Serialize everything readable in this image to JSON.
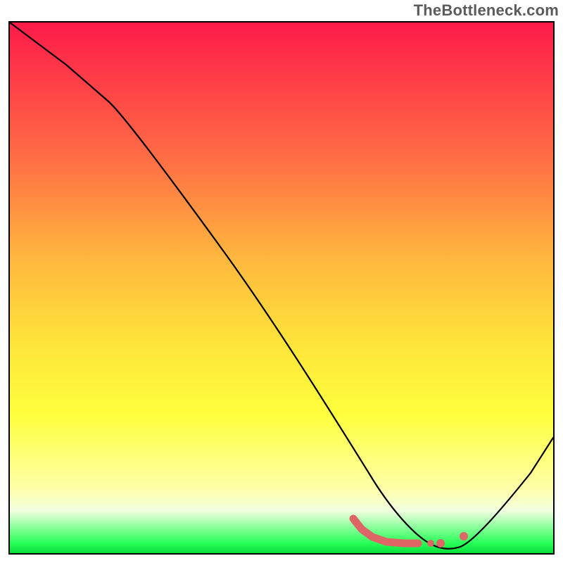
{
  "brand": {
    "watermark": "TheBottleneck.com"
  },
  "chart_data": {
    "type": "line",
    "title": "",
    "xlabel": "",
    "ylabel": "",
    "xlim": [
      0,
      100
    ],
    "ylim": [
      0,
      100
    ],
    "series": [
      {
        "name": "bottleneck-curve",
        "x": [
          0,
          10,
          18,
          28,
          38,
          48,
          58,
          62,
          66,
          70,
          74,
          78,
          80,
          82,
          86,
          92,
          100
        ],
        "y": [
          100,
          92,
          85,
          75,
          62,
          49,
          36,
          29,
          22,
          15,
          9,
          3,
          1.5,
          0.5,
          1.5,
          10,
          28
        ]
      }
    ],
    "markers": {
      "name": "highlight-points",
      "x": [
        62,
        64,
        66,
        68,
        70,
        72,
        75,
        78,
        82
      ],
      "y": [
        4.5,
        3.5,
        2.8,
        2.2,
        1.8,
        1.5,
        1.3,
        1.2,
        3.2
      ]
    },
    "gradient_stops": [
      {
        "pos": 0.0,
        "color": "#fe1b49"
      },
      {
        "pos": 0.25,
        "color": "#ff6b45"
      },
      {
        "pos": 0.45,
        "color": "#ffb93e"
      },
      {
        "pos": 0.6,
        "color": "#fee33a"
      },
      {
        "pos": 0.74,
        "color": "#feff3c"
      },
      {
        "pos": 0.88,
        "color": "#feffaa"
      },
      {
        "pos": 0.92,
        "color": "#f2ffe0"
      },
      {
        "pos": 0.98,
        "color": "#2bff5a"
      },
      {
        "pos": 1.0,
        "color": "#07e03a"
      }
    ]
  }
}
